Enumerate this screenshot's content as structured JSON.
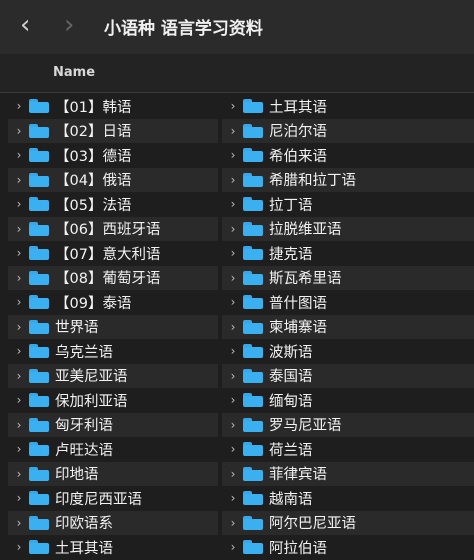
{
  "window": {
    "title": "小语种 语言学习资料",
    "back_icon": "chevron-left-icon",
    "forward_icon": "chevron-right-icon"
  },
  "header": {
    "name_label": "Name"
  },
  "left_items": [
    "【01】韩语",
    "【02】日语",
    "【03】德语",
    "【04】俄语",
    "【05】法语",
    "【06】西班牙语",
    "【07】意大利语",
    "【08】葡萄牙语",
    "【09】泰语",
    "世界语",
    "乌克兰语",
    "亚美尼亚语",
    "保加利亚语",
    "匈牙利语",
    "卢旺达语",
    "印地语",
    "印度尼西亚语",
    "印欧语系",
    "土耳其语"
  ],
  "right_items": [
    "土耳其语",
    "尼泊尔语",
    "希伯来语",
    "希腊和拉丁语",
    "拉丁语",
    "拉脱维亚语",
    "捷克语",
    "斯瓦希里语",
    "普什图语",
    "柬埔寨语",
    "波斯语",
    "泰国语",
    "缅甸语",
    "罗马尼亚语",
    "荷兰语",
    "菲律宾语",
    "越南语",
    "阿尔巴尼亚语",
    "阿拉伯语"
  ],
  "colors": {
    "folder": "#3bb0f0",
    "background": "#1e1e1e"
  }
}
